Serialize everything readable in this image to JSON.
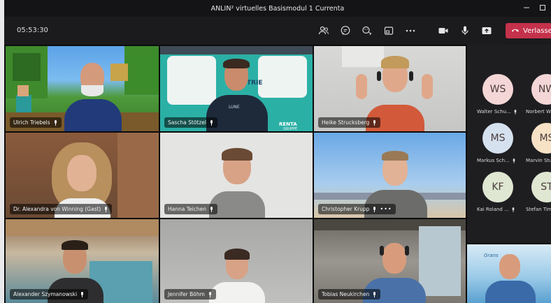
{
  "window": {
    "title": "ANLIN² virtuelles Basismodul 1 Currenta"
  },
  "toolbar": {
    "timer": "05:53:30",
    "leave_label": "Verlassen",
    "icons": [
      "people-icon",
      "chat-icon",
      "reactions-icon",
      "rooms-icon",
      "more-icon",
      "camera-icon",
      "mic-icon",
      "share-icon"
    ]
  },
  "participants": [
    {
      "name": "Ulrich Triebels"
    },
    {
      "name": "Sascha Stötzel"
    },
    {
      "name": "Heike Strucksberg"
    },
    {
      "name": "Dr. Alexandra von Winning (Gast)"
    },
    {
      "name": "Hanna Teichen"
    },
    {
      "name": "Christopher Krupp"
    },
    {
      "name": "Alexander Szymanowski"
    },
    {
      "name": "Jennifer Böhm"
    },
    {
      "name": "Tobias Neukirchen"
    }
  ],
  "roster": [
    {
      "initials": "WS",
      "name": "Walter Schu...",
      "color": "#f4d6d6"
    },
    {
      "initials": "NW",
      "name": "Norbert W",
      "color": "#f4d6d6"
    },
    {
      "initials": "MS",
      "name": "Markus Sch...",
      "color": "#d6e1ef"
    },
    {
      "initials": "MS",
      "name": "Marvin Stu",
      "color": "#f7e2c6"
    },
    {
      "initials": "KF",
      "name": "Kai Roland ...",
      "color": "#dfe7d2"
    },
    {
      "initials": "ST",
      "name": "Stefan Tim",
      "color": "#dfe7d2"
    }
  ],
  "tile_text": {
    "sascha_banner_1": "TRIE",
    "sascha_banner_2": "RENTA",
    "sascha_banner_3": "GRUPPE",
    "sascha_shirt": "LUNE",
    "pip_logo": "Grans"
  },
  "colors": {
    "leave": "#c4314b",
    "toolbar": "#1b1b1d",
    "accent": "#6264a7"
  }
}
